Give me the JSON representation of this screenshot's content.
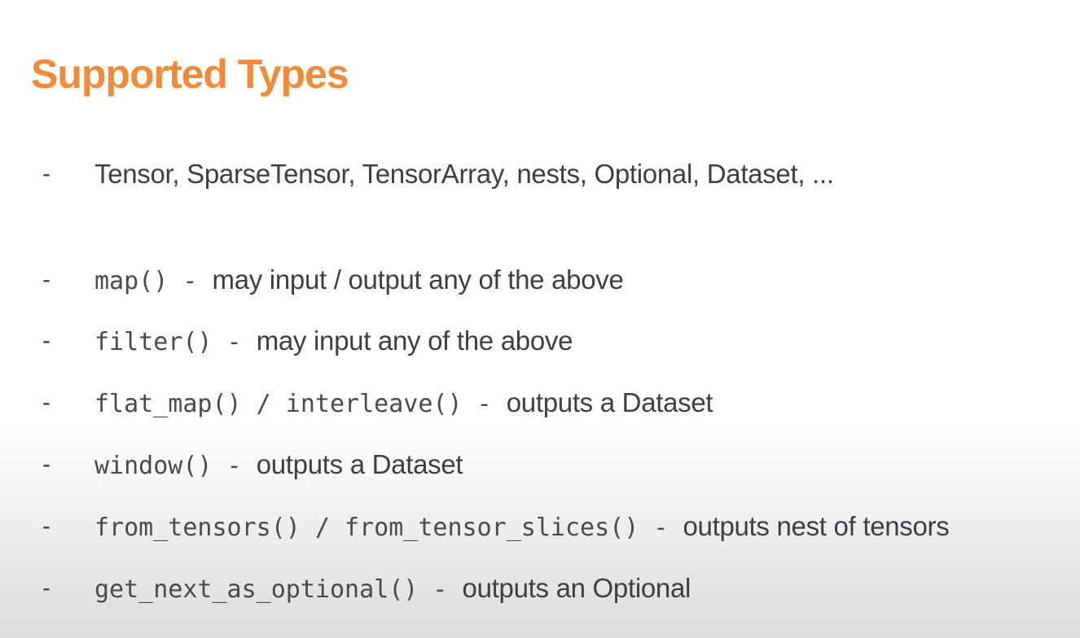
{
  "title": "Supported Types",
  "bullets": [
    {
      "dash": "-",
      "code": "",
      "sep": "",
      "text": "Tensor, SparseTensor, TensorArray, nests, Optional, Dataset, ..."
    },
    {
      "dash": "-",
      "code": "map()",
      "sep": " - ",
      "text": "may input / output any of the above"
    },
    {
      "dash": "-",
      "code": "filter()",
      "sep": " - ",
      "text": "may input any of the above"
    },
    {
      "dash": "-",
      "code": "flat_map() / interleave()",
      "sep": " - ",
      "text": "outputs a Dataset"
    },
    {
      "dash": "-",
      "code": "window()",
      "sep": " - ",
      "text": "outputs a Dataset"
    },
    {
      "dash": "-",
      "code": "from_tensors() / from_tensor_slices()",
      "sep": " - ",
      "text": "outputs nest of tensors"
    },
    {
      "dash": "-",
      "code": "get_next_as_optional()",
      "sep": " - ",
      "text": "outputs an Optional"
    }
  ],
  "colors": {
    "title": "#ef8c3b",
    "text": "#3c4043"
  }
}
